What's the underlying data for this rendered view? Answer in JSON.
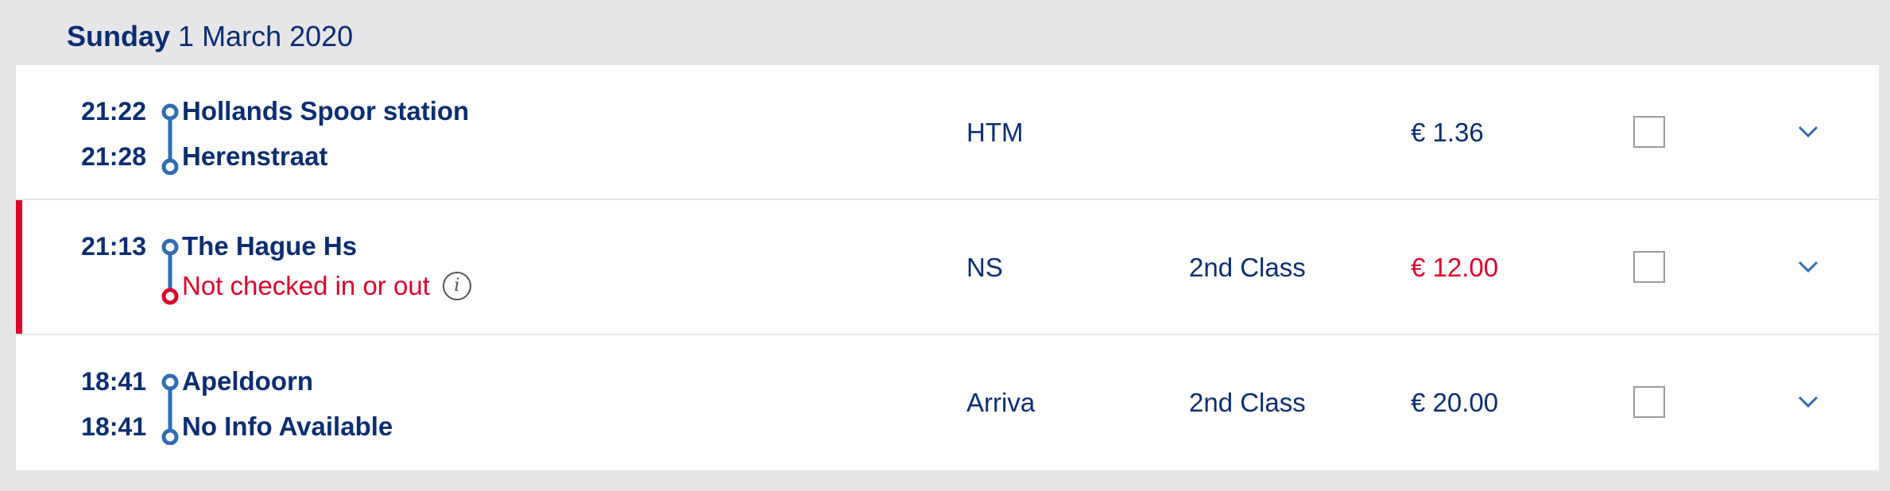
{
  "header": {
    "day": "Sunday",
    "date": "1 March 2020"
  },
  "trips": [
    {
      "departure_time": "21:22",
      "departure_stop": "Hollands Spoor station",
      "arrival_time": "21:28",
      "arrival_stop": "Herenstraat",
      "operator": "HTM",
      "class": "",
      "price": "€ 1.36",
      "status": "ok"
    },
    {
      "departure_time": "21:13",
      "departure_stop": "The Hague Hs",
      "arrival_time": "",
      "arrival_stop": "Not checked in or out",
      "operator": "NS",
      "class": "2nd Class",
      "price": "€ 12.00",
      "status": "error",
      "info_icon": "info-icon"
    },
    {
      "departure_time": "18:41",
      "departure_stop": "Apeldoorn",
      "arrival_time": "18:41",
      "arrival_stop": "No Info Available",
      "operator": "Arriva",
      "class": "2nd Class",
      "price": "€ 20.00",
      "status": "ok"
    }
  ],
  "colors": {
    "primary": "#0b2e72",
    "route": "#2f6db5",
    "error": "#db0029",
    "background": "#e6e6e9"
  }
}
